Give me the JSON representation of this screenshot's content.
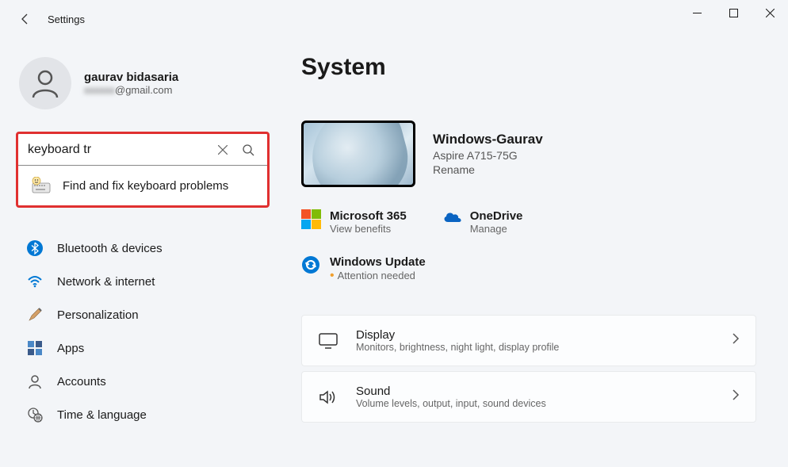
{
  "window": {
    "title": "Settings"
  },
  "profile": {
    "name": "gaurav bidasaria",
    "email_suffix": "@gmail.com"
  },
  "search": {
    "value": "keyboard tr",
    "result": "Find and fix keyboard problems"
  },
  "nav": {
    "items": [
      {
        "label": "Bluetooth & devices",
        "key": "bluetooth"
      },
      {
        "label": "Network & internet",
        "key": "network"
      },
      {
        "label": "Personalization",
        "key": "personalization"
      },
      {
        "label": "Apps",
        "key": "apps"
      },
      {
        "label": "Accounts",
        "key": "accounts"
      },
      {
        "label": "Time & language",
        "key": "time"
      }
    ]
  },
  "page": {
    "title": "System"
  },
  "device": {
    "name": "Windows-Gaurav",
    "model": "Aspire A715-75G",
    "rename": "Rename"
  },
  "services": {
    "ms365": {
      "name": "Microsoft 365",
      "sub": "View benefits"
    },
    "onedrive": {
      "name": "OneDrive",
      "sub": "Manage"
    },
    "update": {
      "name": "Windows Update",
      "sub": "Attention needed"
    }
  },
  "cards": {
    "display": {
      "title": "Display",
      "sub": "Monitors, brightness, night light, display profile"
    },
    "sound": {
      "title": "Sound",
      "sub": "Volume levels, output, input, sound devices"
    }
  }
}
